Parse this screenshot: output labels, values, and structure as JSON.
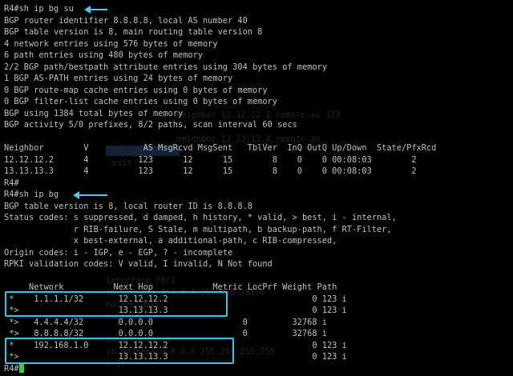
{
  "terminal": {
    "lines": [
      "R4#sh ip bg su",
      "BGP router identifier 8.8.8.8, local AS number 40",
      "BGP table version is 8, main routing table version 8",
      "4 network entries using 576 bytes of memory",
      "6 path entries using 480 bytes of memory",
      "2/2 BGP path/bestpath attribute entries using 304 bytes of memory",
      "1 BGP AS-PATH entries using 24 bytes of memory",
      "0 BGP route-map cache entries using 0 bytes of memory",
      "0 BGP filter-list cache entries using 0 bytes of memory",
      "BGP using 1384 total bytes of memory",
      "BGP activity 5/0 prefixes, 8/2 paths, scan interval 60 secs",
      "",
      "Neighbor        V           AS MsgRcvd MsgSent   TblVer  InQ OutQ Up/Down  State/PfxRcd",
      "12.12.12.2      4          123      12      15        8    0    0 00:08:03        2",
      "13.13.13.3      4          123      12      15        8    0    0 00:08:03        2",
      "R4#",
      "R4#sh ip bg",
      "BGP table version is 8, local router ID is 8.8.8.8",
      "Status codes: s suppressed, d damped, h history, * valid, > best, i - internal,",
      "              r RIB-failure, S Stale, m multipath, b backup-path, f RT-Filter,",
      "              x best-external, a additional-path, c RIB-compressed,",
      "Origin codes: i - IGP, e - EGP, ? - incomplete",
      "RPKI validation codes: V valid, I invalid, N Not found",
      "",
      "     Network          Next Hop            Metric LocPrf Weight Path",
      " *    1.1.1.1/32       12.12.12.2                             0 123 i",
      " *>                    13.13.13.3                             0 123 i",
      " *>   4.4.4.4/32       0.0.0.0                  0         32768 i",
      " *>   8.8.8.8/32       0.0.0.0                  0         32768 i",
      " *    192.168.1.0      12.12.12.2                             0 123 i",
      " *>                    13.13.13.3                             0 123 i"
    ],
    "prompt_last": "R4#",
    "ghost": [
      "neighbor 12.12.12.2 remote-as 123",
      "neighbor 13.13.13.4 remote-as",
      "Neighbor",
      "exit",
      "interface f0/1",
      "ip address 4.4.4.4 255.255.255.0",
      "no shutdown",
      "exit",
      "interface lo0",
      "ip address 8.8.8.8 255.255.255.255",
      "exit"
    ]
  },
  "colors": {
    "background": "#000000",
    "text": "#c0c0c0",
    "annotation": "#39c6e8",
    "cursor": "#2ad63a"
  }
}
